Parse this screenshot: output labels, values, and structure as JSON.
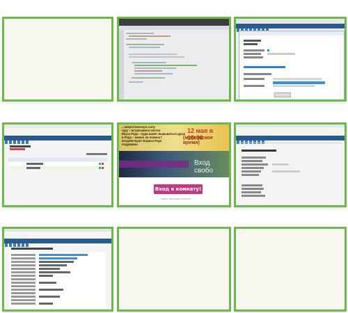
{
  "grid": {
    "border_color": "#6cb84a",
    "blank_color": "#f7f6ef"
  },
  "tiles": [
    {
      "kind": "blank"
    },
    {
      "kind": "code-editor"
    },
    {
      "kind": "settings-dialog"
    },
    {
      "kind": "admin-table"
    },
    {
      "kind": "promo-banner",
      "headline_lines": [
        "...энергетическую силу",
        "гуру – встречаемся честно",
        "Вкуса Рода – куда может вырываться душа",
        "в Рода – можно ли помочь?",
        "воздействуют Бориса Рода",
        "поддержки"
      ],
      "date_line_1": "12 мая в 19:00",
      "date_line_2": "(московское время)",
      "overlay_text": "Вход свобо",
      "enter_button": "Вход в комнату!",
      "caption": "Запись трансляции тренинга"
    },
    {
      "kind": "settings-form"
    },
    {
      "kind": "detail-table"
    },
    {
      "kind": "blank"
    },
    {
      "kind": "blank"
    }
  ],
  "icons": {
    "close": "close-icon",
    "edit": "edit-icon",
    "delete": "delete-icon"
  }
}
